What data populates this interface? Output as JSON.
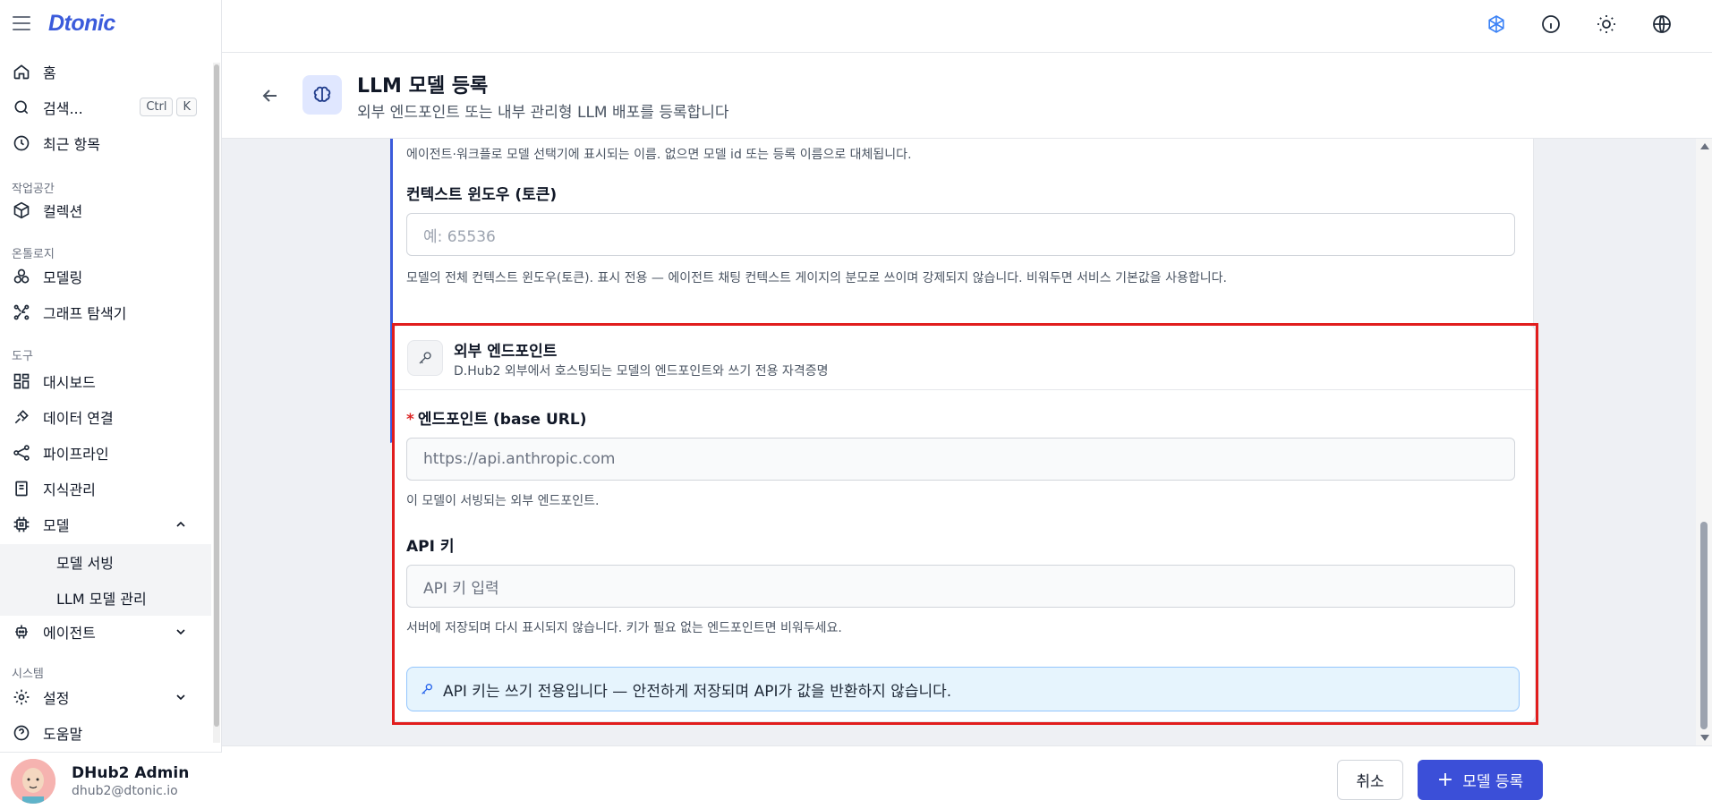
{
  "app": {
    "logo": "Dtonic"
  },
  "sidebar": {
    "home": "홈",
    "search": "검색...",
    "search_kbd": [
      "Ctrl",
      "K"
    ],
    "recent": "최근 항목",
    "section_workspace": "작업공간",
    "collection": "컬렉션",
    "section_ontology": "온톨로지",
    "modeling": "모델링",
    "graph_explorer": "그래프 탐색기",
    "section_tools": "도구",
    "dashboard": "대시보드",
    "data_connection": "데이터 연결",
    "pipeline": "파이프라인",
    "knowledge": "지식관리",
    "model": "모델",
    "model_serving": "모델 서빙",
    "llm_model_mgmt": "LLM 모델 관리",
    "agent": "에이전트",
    "section_system": "시스템",
    "settings": "설정",
    "help": "도움말"
  },
  "user": {
    "name": "DHub2 Admin",
    "email": "dhub2@dtonic.io"
  },
  "header": {
    "title": "LLM 모델 등록",
    "subtitle": "외부 엔드포인트 또는 내부 관리형 LLM 배포를 등록합니다"
  },
  "form": {
    "display_name_hint": "에이전트·워크플로 모델 선택기에 표시되는 이름. 없으면 모델 id 또는 등록 이름으로 대체됩니다.",
    "context_window_label": "컨텍스트 윈도우 (토큰)",
    "context_window_placeholder": "예: 65536",
    "context_window_hint": "모델의 전체 컨텍스트 윈도우(토큰). 표시 전용 — 에이전트 채팅 컨텍스트 게이지의 분모로 쓰이며 강제되지 않습니다. 비워두면 서비스 기본값을 사용합니다.",
    "external": {
      "title": "외부 엔드포인트",
      "desc": "D.Hub2 외부에서 호스팅되는 모델의 엔드포인트와 쓰기 전용 자격증명",
      "required_mark": "*",
      "endpoint_label": "엔드포인트 (base URL)",
      "endpoint_placeholder": "https://api.anthropic.com",
      "endpoint_hint": "이 모델이 서빙되는 외부 엔드포인트.",
      "apikey_label": "API 키",
      "apikey_placeholder": "API 키 입력",
      "apikey_hint": "서버에 저장되며 다시 표시되지 않습니다. 키가 필요 없는 엔드포인트면 비워두세요.",
      "info": "API 키는 쓰기 전용입니다 — 안전하게 저장되며 API가 값을 반환하지 않습니다."
    }
  },
  "footer": {
    "cancel": "취소",
    "submit": "모델 등록",
    "submit_icon": "+"
  },
  "colors": {
    "accent": "#3b4fd8",
    "highlight": "#e11d1d",
    "info_bg": "#e6f4fd"
  }
}
